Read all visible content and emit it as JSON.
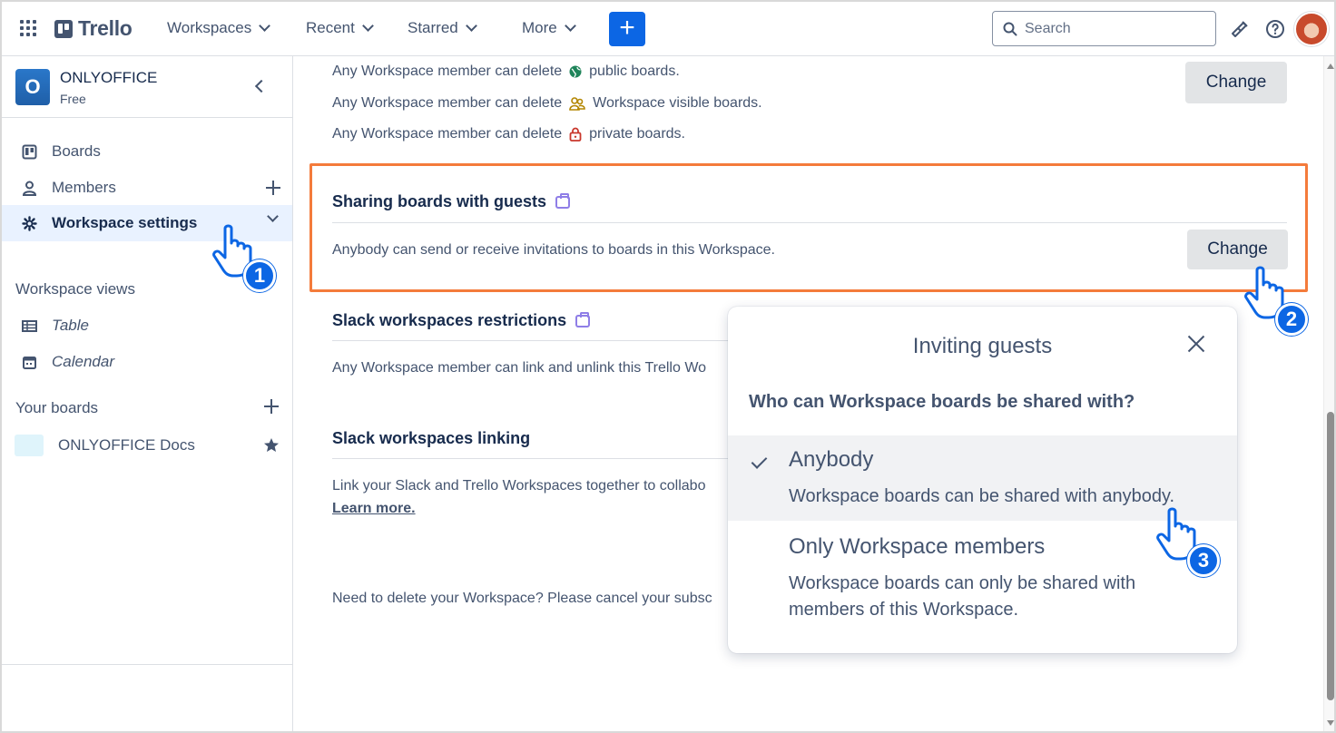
{
  "topbar": {
    "logo_text": "Trello",
    "nav": [
      {
        "label": "Workspaces"
      },
      {
        "label": "Recent"
      },
      {
        "label": "Starred"
      },
      {
        "label": "More"
      }
    ],
    "create_label": "+",
    "search_placeholder": "Search"
  },
  "sidebar": {
    "workspace_initial": "O",
    "workspace_name": "ONLYOFFICE",
    "workspace_plan": "Free",
    "items": [
      {
        "label": "Boards",
        "icon": "board-icon"
      },
      {
        "label": "Members",
        "icon": "person-icon"
      },
      {
        "label": "Workspace settings",
        "icon": "gear-icon"
      }
    ],
    "views_heading": "Workspace views",
    "views": [
      {
        "label": "Table",
        "icon": "table-icon"
      },
      {
        "label": "Calendar",
        "icon": "calendar-icon"
      }
    ],
    "boards_heading": "Your boards",
    "boards": [
      {
        "label": "ONLYOFFICE Docs"
      }
    ]
  },
  "main": {
    "deletion": {
      "line_prefix": "Any Workspace member can delete",
      "public": "public boards.",
      "workspace_visible": "Workspace visible boards.",
      "private": "private boards.",
      "change_label": "Change"
    },
    "sharing": {
      "title": "Sharing boards with guests",
      "description": "Anybody can send or receive invitations to boards in this Workspace.",
      "change_label": "Change"
    },
    "slack_restrictions": {
      "title": "Slack workspaces restrictions",
      "description": "Any Workspace member can link and unlink this Trello Wo"
    },
    "slack_linking": {
      "title": "Slack workspaces linking",
      "description": "Link your Slack and Trello Workspaces together to collabo",
      "learn_more": "Learn more."
    },
    "delete_workspace": "Need to delete your Workspace? Please cancel your subsc"
  },
  "popover": {
    "title": "Inviting guests",
    "question": "Who can Workspace boards be shared with?",
    "options": [
      {
        "title": "Anybody",
        "description": "Workspace boards can be shared with anybody.",
        "selected": true
      },
      {
        "title": "Only Workspace members",
        "description_line1": "Workspace boards can only be shared with",
        "description_line2": "members of this Workspace.",
        "selected": false
      }
    ]
  },
  "annotations": {
    "steps": [
      "1",
      "2",
      "3"
    ]
  },
  "colors": {
    "accent": "#0c66e4",
    "highlight_border": "#f47b3b",
    "active_item_bg": "#e9f2ff",
    "premium_icon": "#8f7ee7"
  }
}
